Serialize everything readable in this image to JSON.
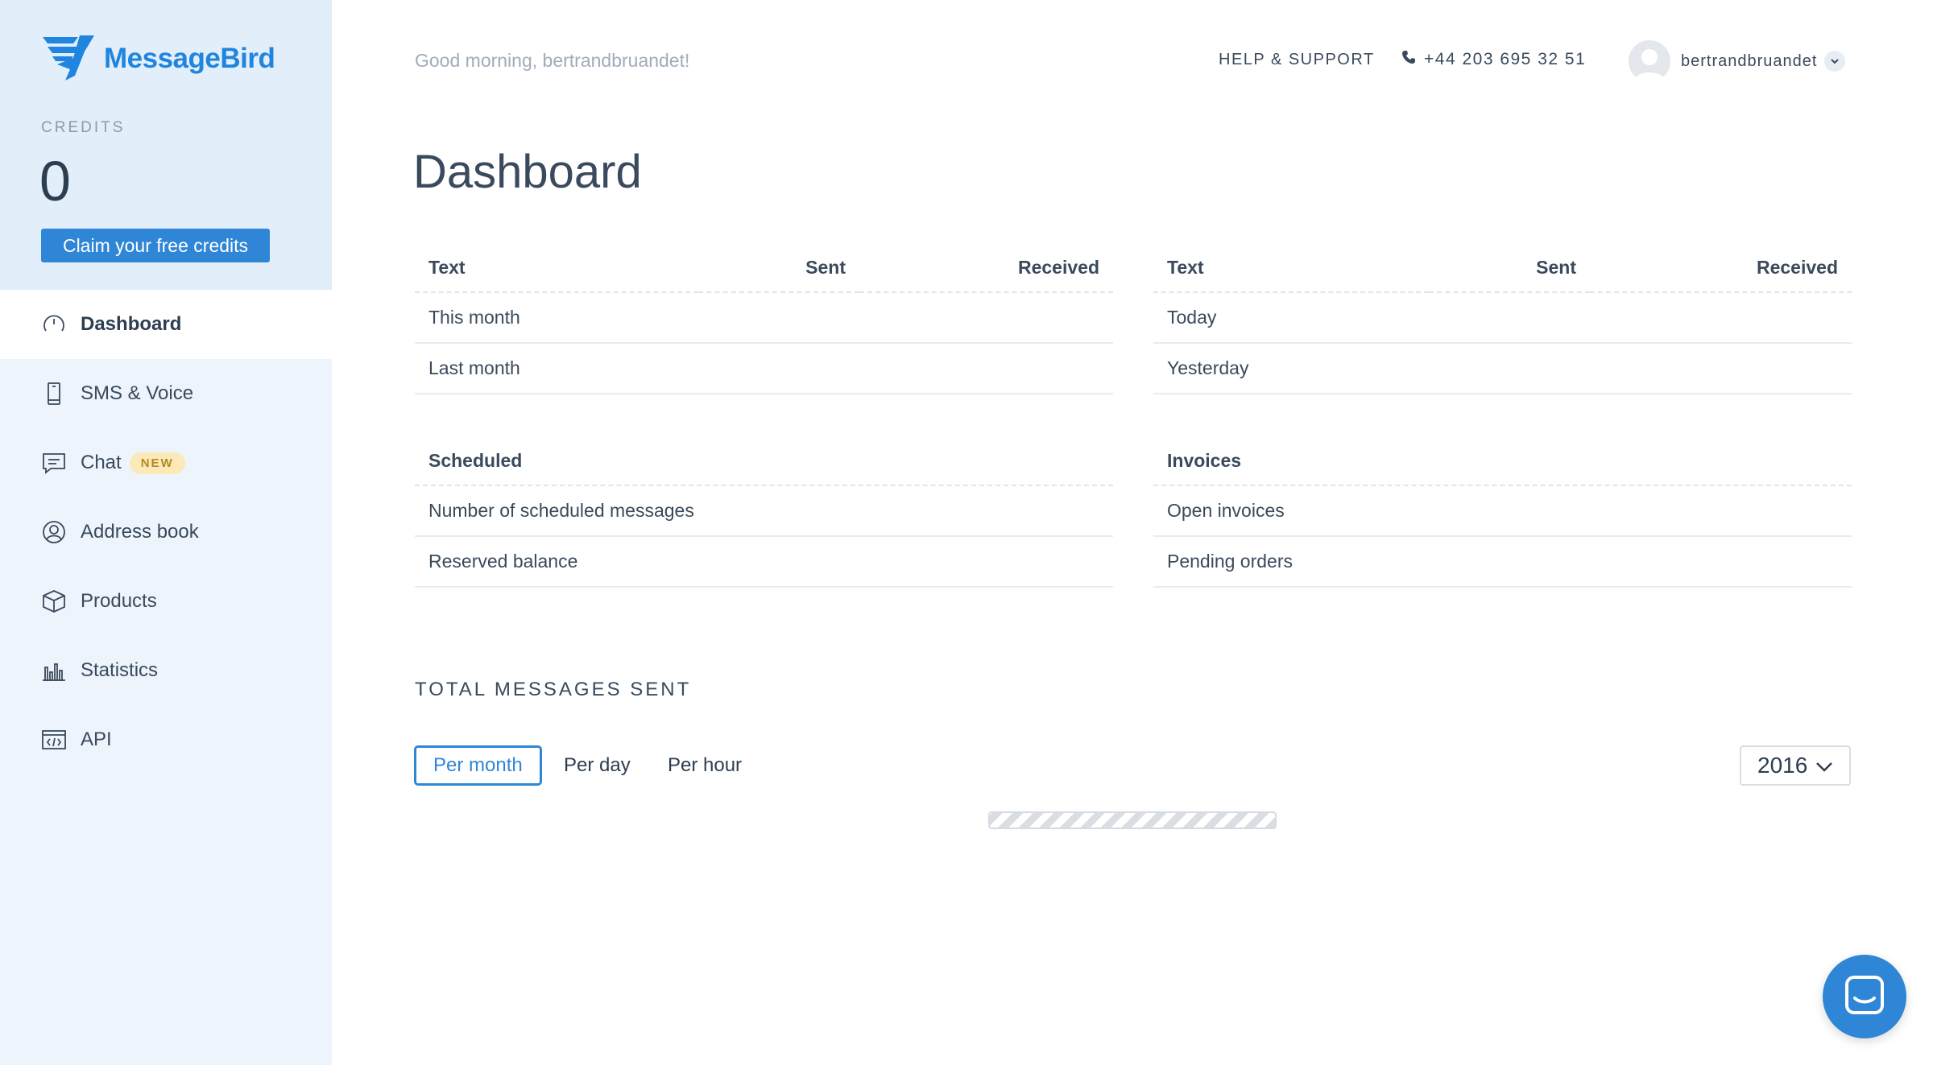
{
  "brand": {
    "name": "MessageBird",
    "color": "#1f85de"
  },
  "sidebar": {
    "credits_label": "CREDITS",
    "credits_value": "0",
    "claim_label": "Claim your free credits",
    "items": [
      {
        "label": "Dashboard",
        "icon": "dashboard-gauge-icon",
        "active": true
      },
      {
        "label": "SMS & Voice",
        "icon": "mobile-phone-icon"
      },
      {
        "label": "Chat",
        "icon": "chat-bubble-icon",
        "badge": "NEW"
      },
      {
        "label": "Address book",
        "icon": "contact-user-icon"
      },
      {
        "label": "Products",
        "icon": "box-icon"
      },
      {
        "label": "Statistics",
        "icon": "bar-chart-icon"
      },
      {
        "label": "API",
        "icon": "code-window-icon"
      }
    ]
  },
  "header": {
    "greeting": "Good morning, bertrandbruandet!",
    "help": "HELP & SUPPORT",
    "phone": "+44 203 695 32 51",
    "username": "bertrandbruandet"
  },
  "main": {
    "title": "Dashboard",
    "tables": {
      "text_month": {
        "headers": [
          "Text",
          "Sent",
          "Received"
        ],
        "rows": [
          "This month",
          "Last month"
        ]
      },
      "text_day": {
        "headers": [
          "Text",
          "Sent",
          "Received"
        ],
        "rows": [
          "Today",
          "Yesterday"
        ]
      },
      "scheduled": {
        "header": "Scheduled",
        "rows": [
          "Number of scheduled messages",
          "Reserved balance"
        ]
      },
      "invoices": {
        "header": "Invoices",
        "rows": [
          "Open invoices",
          "Pending orders"
        ]
      }
    },
    "total_title": "TOTAL MESSAGES SENT",
    "periods": [
      "Per month",
      "Per day",
      "Per hour"
    ],
    "active_period": "Per month",
    "year": "2016"
  },
  "colors": {
    "accent": "#2f86d6",
    "sidebar_bg": "#eef4fb",
    "badge_bg": "#fbeab8"
  }
}
